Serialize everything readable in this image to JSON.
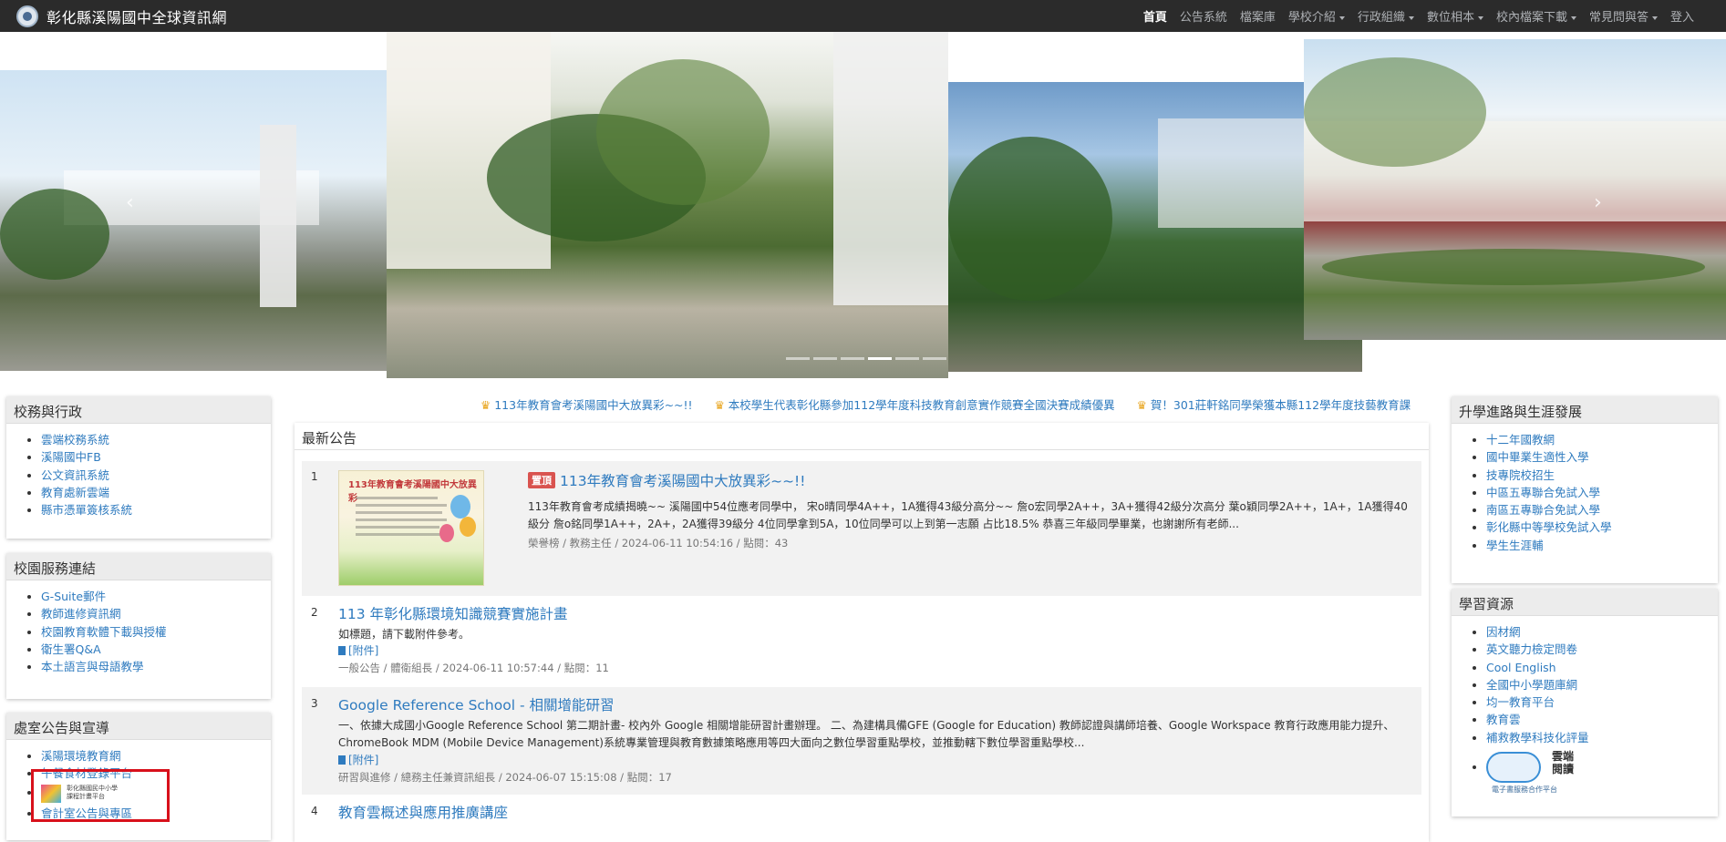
{
  "navbar": {
    "title": "彰化縣溪陽國中全球資訊網",
    "items": [
      {
        "label": "首頁",
        "active": true,
        "dropdown": false
      },
      {
        "label": "公告系統",
        "active": false,
        "dropdown": false
      },
      {
        "label": "檔案庫",
        "active": false,
        "dropdown": false
      },
      {
        "label": "學校介紹",
        "active": false,
        "dropdown": true
      },
      {
        "label": "行政組織",
        "active": false,
        "dropdown": true
      },
      {
        "label": "數位相本",
        "active": false,
        "dropdown": true
      },
      {
        "label": "校內檔案下載",
        "active": false,
        "dropdown": true
      },
      {
        "label": "常見問與答",
        "active": false,
        "dropdown": true
      },
      {
        "label": "登入",
        "active": false,
        "dropdown": false
      }
    ]
  },
  "carousel": {
    "active_index": 3,
    "indicator_count": 6,
    "prev_glyph": "‹",
    "next_glyph": "›"
  },
  "left_panels": [
    {
      "title": "校務與行政",
      "links": [
        "雲端校務系統",
        "溪陽國中FB",
        "公文資訊系統",
        "教育處新雲端",
        "縣市憑單簽核系統"
      ]
    },
    {
      "title": "校園服務連結",
      "links": [
        "G-Suite郵件",
        "教師進修資訊網",
        "校園教育軟體下載與授權",
        "衛生署Q&A",
        "本土語言與母語教學"
      ]
    },
    {
      "title": "處室公告與宣導",
      "links": [
        "溪陽環境教育網",
        "午餐食材登錄平台"
      ],
      "logo_text_1": "彰化縣國民中小學",
      "logo_text_2": "課程計畫平台",
      "partial_link": "會計室公告與專區"
    }
  ],
  "marquee": [
    "113年教育會考溪陽國中大放異彩~~!!",
    "本校學生代表彰化縣參加112學年度科技教育創意實作競賽全國決賽成績優異",
    "賀！301莊軒銘同學榮獲本縣112學年度技藝教育課"
  ],
  "announcements": {
    "heading": "最新公告",
    "items": [
      {
        "num": "1",
        "pinned": true,
        "pin_label": "置頂",
        "title": "113年教育會考溪陽國中大放異彩~~!!",
        "summary": "113年教育會考成績揭曉~~ 溪陽國中54位應考同學中， 宋o晴同學4A++，1A獲得43級分高分~~ 詹o宏同學2A++，3A+獲得42級分次高分 葉o穎同學2A++，1A+，1A獲得40級分 詹o銘同學1A++，2A+，2A獲得39級分 4位同學拿到5A，10位同學可以上到第一志願 占比18.5% 恭喜三年級同學畢業，也謝謝所有老師...",
        "meta": "榮譽榜 / 教務主任 / 2024-06-11 10:54:16 / 點閱：43",
        "thumb_title": "113年教育會考溪陽國中大放異彩"
      },
      {
        "num": "2",
        "title": "113 年彰化縣環境知識競賽實施計畫",
        "summary": "如標題，請下載附件參考。",
        "attach": "[附件]",
        "meta": "一般公告 / 體衛組長 / 2024-06-11 10:57:44 / 點閱：11"
      },
      {
        "num": "3",
        "title": "Google Reference School - 相關增能研習",
        "summary": "一、依據大成國小Google Reference School 第二期計畫- 校內外 Google 相關增能研習計畫辦理。 二、為建構具備GFE (Google for Education) 教師認證與講師培養、Google Workspace 教育行政應用能力提升、ChromeBook MDM (Mobile Device Management)系統專業管理與教育數據策略應用等四大面向之數位學習重點學校，並推動轄下數位學習重點學校...",
        "attach": "[附件]",
        "meta": "研習與進修 / 總務主任兼資訊組長 / 2024-06-07 15:15:08 / 點閱：17"
      },
      {
        "num": "4",
        "title": "教育雲概述與應用推廣講座"
      }
    ]
  },
  "right_panels": [
    {
      "title": "升學進路與生涯發展",
      "links": [
        "十二年國教網",
        "國中畢業生適性入學",
        "技專院校招生",
        "中區五專聯合免試入學",
        "南區五專聯合免試入學",
        "彰化縣中等學校免試入學",
        "學生生涯輔"
      ]
    },
    {
      "title": "學習資源",
      "links": [
        "因材網",
        "英文聽力檢定問卷",
        "Cool English",
        "全國中小學題庫網",
        "均一教育平台",
        "教育雲",
        "補救教學科技化評量"
      ],
      "cloud_logo_1": "雲端",
      "cloud_logo_2": "閱讀",
      "cloud_logo_3": "電子書服務合作平台"
    }
  ],
  "colors": {
    "navbar_bg": "#2b2b2b",
    "link": "#2f7bbf",
    "pin_badge": "#d9534f",
    "highlight_box": "#d8101b"
  }
}
